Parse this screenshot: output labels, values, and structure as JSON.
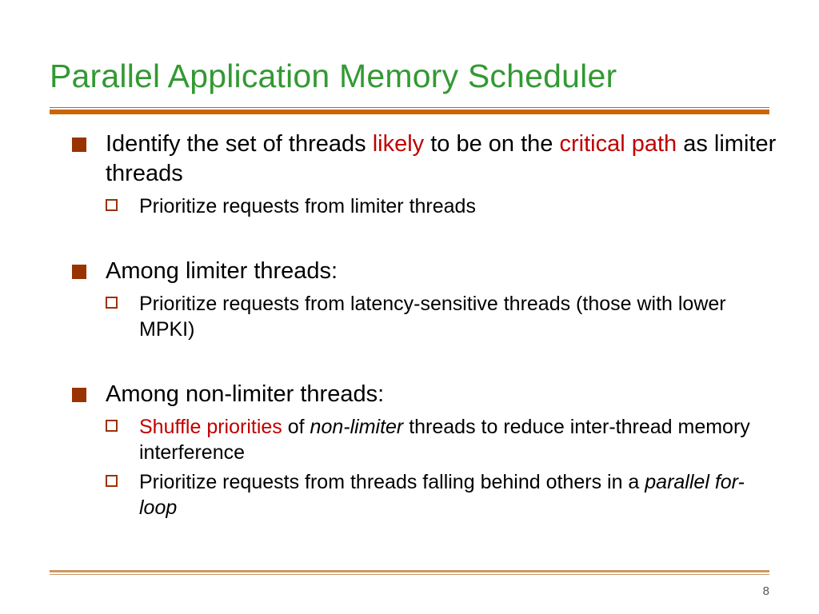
{
  "title": "Parallel Application Memory Scheduler",
  "page_number": "8",
  "bullets": {
    "b1_pre": "Identify the set of threads ",
    "b1_likely": "likely",
    "b1_mid": " to be on the ",
    "b1_crit": "critical path",
    "b1_post": " as limiter threads",
    "b1_s1": "Prioritize requests from limiter threads",
    "b2": "Among limiter threads:",
    "b2_s1": "Prioritize requests from latency-sensitive threads (those with lower MPKI)",
    "b3": "Among non-limiter threads:",
    "b3_s1_pre": "Shuffle priorities",
    "b3_s1_mid": " of ",
    "b3_s1_ital": "non-limiter",
    "b3_s1_post": " threads to reduce inter-thread memory interference",
    "b3_s2_pre": "Prioritize requests from threads falling behind others in a ",
    "b3_s2_ital": "parallel for-loop"
  }
}
